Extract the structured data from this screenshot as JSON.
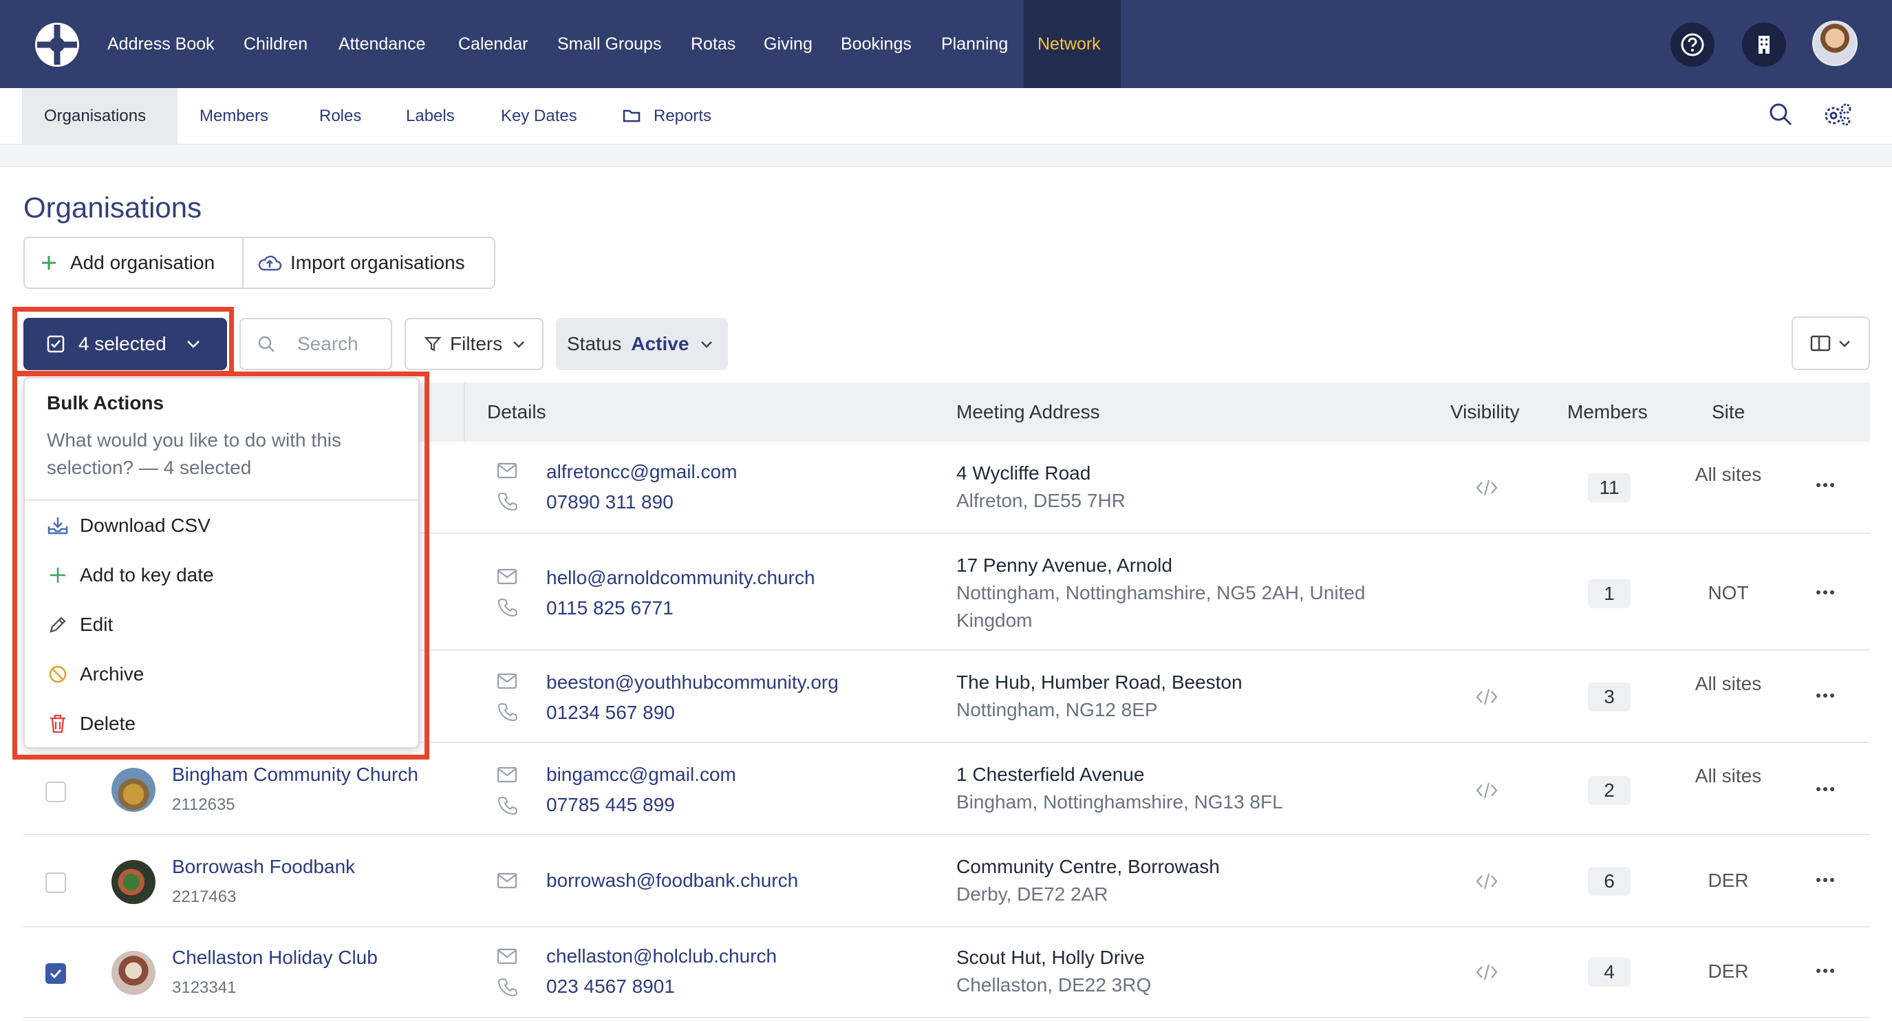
{
  "nav": {
    "items": [
      "Address Book",
      "Children",
      "Attendance",
      "Calendar",
      "Small Groups",
      "Rotas",
      "Giving",
      "Bookings",
      "Planning",
      "Network"
    ],
    "active": "Network",
    "active_color": "#f5c33b"
  },
  "subnav": {
    "items": [
      "Organisations",
      "Members",
      "Roles",
      "Labels",
      "Key Dates",
      "Reports"
    ],
    "active": "Organisations"
  },
  "page": {
    "title": "Organisations",
    "add_label": "Add organisation",
    "import_label": "Import organisations"
  },
  "toolbar": {
    "selected_label": "4 selected",
    "search_placeholder": "Search",
    "filters_label": "Filters",
    "status_label": "Status",
    "status_value": "Active"
  },
  "table": {
    "headers": {
      "details": "Details",
      "address": "Meeting Address",
      "visibility": "Visibility",
      "members": "Members",
      "site": "Site"
    },
    "rows": [
      {
        "name": "",
        "id": "",
        "email": "alfretoncc@gmail.com",
        "phone": "07890 311 890",
        "addr1": "4 Wycliffe Road",
        "addr2": "Alfreton, DE55 7HR",
        "visibility_icon": "code-icon",
        "members": "11",
        "site": "All sites",
        "checked": true
      },
      {
        "name": "",
        "id": "",
        "email": "hello@arnoldcommunity.church",
        "phone": "0115 825 6771",
        "addr1": "17 Penny Avenue, Arnold",
        "addr2": "Nottingham, Nottinghamshire, NG5 2AH, United",
        "addr3": "Kingdom",
        "visibility_icon": "",
        "members": "1",
        "site": "NOT",
        "checked": true
      },
      {
        "name": "",
        "id": "",
        "email": "beeston@youthhubcommunity.org",
        "phone": "01234 567 890",
        "addr1": "The Hub, Humber Road, Beeston",
        "addr2": "Nottingham, NG12 8EP",
        "visibility_icon": "code-icon",
        "members": "3",
        "site": "All sites",
        "checked": true
      },
      {
        "name": "Bingham Community Church",
        "id": "2112635",
        "email": "bingamcc@gmail.com",
        "phone": "07785 445 899",
        "addr1": "1 Chesterfield Avenue",
        "addr2": "Bingham, Nottinghamshire, NG13 8FL",
        "visibility_icon": "code-icon",
        "members": "2",
        "site": "All sites",
        "checked": false
      },
      {
        "name": "Borrowash Foodbank",
        "id": "2217463",
        "email": "borrowash@foodbank.church",
        "phone": "",
        "addr1": "Community Centre, Borrowash",
        "addr2": "Derby, DE72 2AR",
        "visibility_icon": "code-icon",
        "members": "6",
        "site": "DER",
        "checked": false
      },
      {
        "name": "Chellaston Holiday Club",
        "id": "3123341",
        "email": "chellaston@holclub.church",
        "phone": "023 4567 8901",
        "addr1": "Scout Hut, Holly Drive",
        "addr2": "Chellaston, DE22 3RQ",
        "visibility_icon": "code-icon",
        "members": "4",
        "site": "DER",
        "checked": true
      }
    ]
  },
  "bulk_menu": {
    "title": "Bulk Actions",
    "desc_line1": "What would you like to do with this",
    "desc_line2": "selection? — 4 selected",
    "items": [
      "Download CSV",
      "Add to key date",
      "Edit",
      "Archive",
      "Delete"
    ]
  },
  "colors": {
    "nav_bg": "#323e6d",
    "accent": "#2f3c72",
    "highlight": "#e6452c",
    "add_green": "#3aa657",
    "archive_orange": "#e0a22b",
    "delete_red": "#e0413a"
  }
}
